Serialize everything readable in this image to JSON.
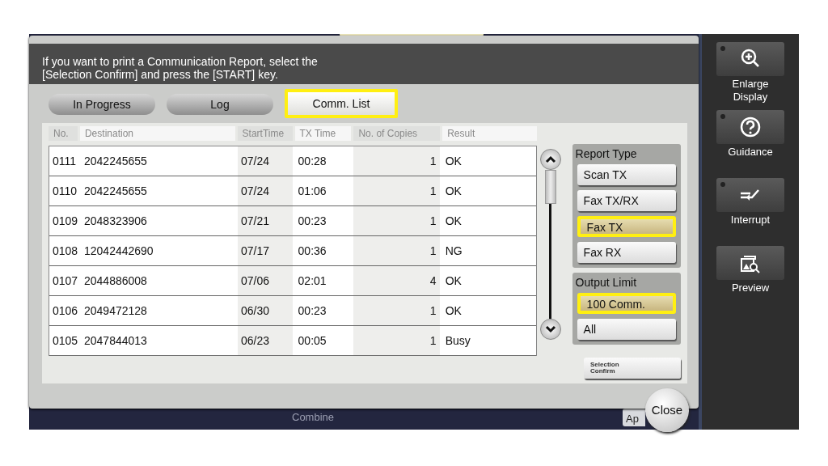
{
  "message": "If you want to print a Communication Report, select the [Selection Confirm] and press the [START] key.",
  "tabs": [
    {
      "label": "In Progress",
      "selected": false
    },
    {
      "label": "Log",
      "selected": false
    },
    {
      "label": "Comm. List",
      "selected": true
    }
  ],
  "table": {
    "columns": [
      "No.",
      "Destination",
      "StartTime",
      "TX Time",
      "No. of Copies",
      "Result"
    ],
    "rows": [
      [
        "0111",
        "2042245655",
        "07/24",
        "00:28",
        "1",
        "OK"
      ],
      [
        "0110",
        "2042245655",
        "07/24",
        "01:06",
        "1",
        "OK"
      ],
      [
        "0109",
        "2048323906",
        "07/21",
        "00:23",
        "1",
        "OK"
      ],
      [
        "0108",
        "12042442690",
        "07/17",
        "00:36",
        "1",
        "NG"
      ],
      [
        "0107",
        "2044886008",
        "07/06",
        "02:01",
        "4",
        "OK"
      ],
      [
        "0106",
        "2049472128",
        "06/30",
        "00:23",
        "1",
        "OK"
      ],
      [
        "0105",
        "2047844013",
        "06/23",
        "00:05",
        "1",
        "Busy"
      ]
    ]
  },
  "report_type": {
    "label": "Report Type",
    "options": [
      {
        "label": "Scan TX",
        "selected": false
      },
      {
        "label": "Fax TX/RX",
        "selected": false
      },
      {
        "label": "Fax TX",
        "selected": true
      },
      {
        "label": "Fax RX",
        "selected": false
      }
    ]
  },
  "output_limit": {
    "label": "Output Limit",
    "options": [
      {
        "label": "100 Comm.",
        "selected": true
      },
      {
        "label": "All",
        "selected": false
      }
    ]
  },
  "selection_confirm": "Selection Confirm",
  "close": "Close",
  "background_bar": {
    "items": [
      "Combine",
      "Ap"
    ]
  },
  "side_buttons": [
    {
      "kind": "zoom",
      "label": "Enlarge Display"
    },
    {
      "kind": "help",
      "label": "Guidance"
    },
    {
      "kind": "interrupt",
      "label": "Interrupt"
    },
    {
      "kind": "preview",
      "label": "Preview"
    }
  ]
}
